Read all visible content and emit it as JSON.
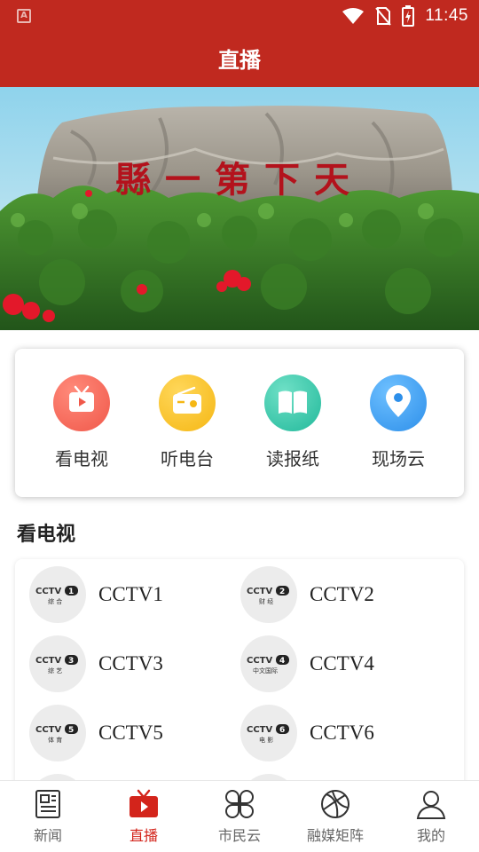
{
  "status_bar": {
    "time": "11:45"
  },
  "header": {
    "title": "直播"
  },
  "banner": {
    "carved_text": "縣一第下天",
    "slide_count": 4,
    "active_slide": 1
  },
  "quick_entries": [
    {
      "label": "看电视",
      "icon": "tv-icon",
      "color": "#f26458"
    },
    {
      "label": "听电台",
      "icon": "radio-icon",
      "color": "#f7be1e"
    },
    {
      "label": "读报纸",
      "icon": "book-icon",
      "color": "#2fc4a8"
    },
    {
      "label": "现场云",
      "icon": "location-pin-icon",
      "color": "#3a9cf2"
    }
  ],
  "tv_section": {
    "title": "看电视",
    "channels": [
      {
        "name": "CCTV1",
        "logo_sub": "综合",
        "logo_num": "1"
      },
      {
        "name": "CCTV2",
        "logo_sub": "财经",
        "logo_num": "2"
      },
      {
        "name": "CCTV3",
        "logo_sub": "综艺",
        "logo_num": "3"
      },
      {
        "name": "CCTV4",
        "logo_sub": "中文国际",
        "logo_num": "4"
      },
      {
        "name": "CCTV5",
        "logo_sub": "体育",
        "logo_num": "5"
      },
      {
        "name": "CCTV6",
        "logo_sub": "电影",
        "logo_num": "6"
      }
    ]
  },
  "bottom_nav": {
    "items": [
      {
        "label": "新闻",
        "icon": "newspaper-icon"
      },
      {
        "label": "直播",
        "icon": "live-tv-icon",
        "active": true
      },
      {
        "label": "市民云",
        "icon": "clover-grid-icon"
      },
      {
        "label": "融媒矩阵",
        "icon": "media-matrix-icon"
      },
      {
        "label": "我的",
        "icon": "user-icon"
      }
    ]
  },
  "colors": {
    "brand_red": "#c0291f",
    "active_nav": "#d3241b",
    "dot_active": "#1e88e5"
  }
}
